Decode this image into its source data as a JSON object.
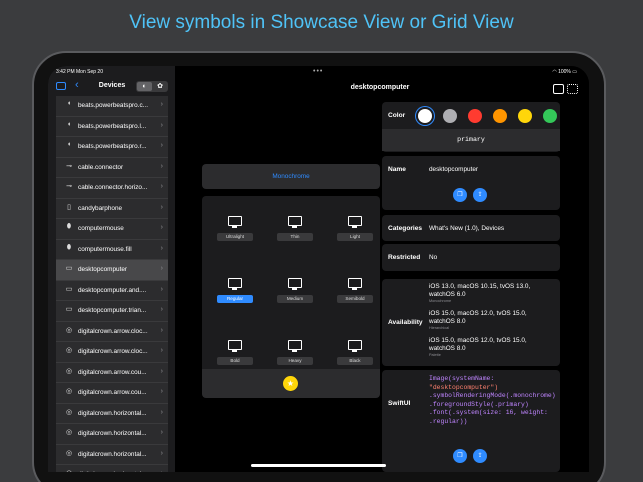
{
  "headline": "View symbols in Showcase View or Grid View",
  "status": {
    "time": "3:42 PM",
    "date": "Mon Sep 20",
    "battery": "100%"
  },
  "sidebar": {
    "title": "Devices",
    "items": [
      {
        "label": "beats.powerbeatspro.c...",
        "icon": "earbud-icon"
      },
      {
        "label": "beats.powerbeatspro.l...",
        "icon": "earbud-icon"
      },
      {
        "label": "beats.powerbeatspro.r...",
        "icon": "earbud-icon"
      },
      {
        "label": "cable.connector",
        "icon": "cable-icon"
      },
      {
        "label": "cable.connector.horizo...",
        "icon": "cable-icon"
      },
      {
        "label": "candybarphone",
        "icon": "phone-icon"
      },
      {
        "label": "computermouse",
        "icon": "mouse-icon"
      },
      {
        "label": "computermouse.fill",
        "icon": "mouse-icon"
      },
      {
        "label": "desktopcomputer",
        "icon": "desktop-icon",
        "selected": true
      },
      {
        "label": "desktopcomputer.and....",
        "icon": "desktop-icon"
      },
      {
        "label": "desktopcomputer.trian...",
        "icon": "desktop-icon"
      },
      {
        "label": "digitalcrown.arrow.cloc...",
        "icon": "crown-icon"
      },
      {
        "label": "digitalcrown.arrow.cloc...",
        "icon": "crown-icon"
      },
      {
        "label": "digitalcrown.arrow.cou...",
        "icon": "crown-icon"
      },
      {
        "label": "digitalcrown.arrow.cou...",
        "icon": "crown-icon"
      },
      {
        "label": "digitalcrown.horizontal...",
        "icon": "crown-icon"
      },
      {
        "label": "digitalcrown.horizontal...",
        "icon": "crown-icon"
      },
      {
        "label": "digitalcrown.horizontal...",
        "icon": "crown-icon"
      },
      {
        "label": "digitalcrown.horizontal...",
        "icon": "crown-icon"
      }
    ]
  },
  "main": {
    "title": "desktopcomputer",
    "rendering_mode": "Monochrome",
    "weights": [
      "Ultralight",
      "Thin",
      "Light",
      "Regular",
      "Medium",
      "Semibold",
      "Bold",
      "Heavy",
      "Black"
    ],
    "selected_weight": "Regular"
  },
  "details": {
    "color_label": "Color",
    "colors": [
      "#ffffff",
      "#aeaeb2",
      "#ff3b30",
      "#ff9500",
      "#ffd60a",
      "#34c759"
    ],
    "color_name": "primary",
    "name_label": "Name",
    "name_value": "desktopcomputer",
    "categories_label": "Categories",
    "categories_value": "What's New (1.0), Devices",
    "restricted_label": "Restricted",
    "restricted_value": "No",
    "availability_label": "Availability",
    "availability": [
      {
        "line1": "iOS 13.0, macOS 10.15, tvOS 13.0,",
        "line2": "watchOS 6.0",
        "mode": "Monochrome"
      },
      {
        "line1": "iOS 15.0, macOS 12.0, tvOS 15.0,",
        "line2": "watchOS 8.0",
        "mode": "Hierarchical"
      },
      {
        "line1": "iOS 15.0, macOS 12.0, tvOS 15.0,",
        "line2": "watchOS 8.0",
        "mode": "Palette"
      }
    ],
    "swiftui_label": "SwiftUI",
    "code": [
      {
        "text": "Image(systemName:",
        "color": "#bf85ff"
      },
      {
        "text": "\"desktopcomputer\")",
        "color": "#ff8170"
      },
      {
        "text": ".symbolRenderingMode(.monochrome)",
        "color": "#bf85ff"
      },
      {
        "text": ".foregroundStyle(.primary)",
        "color": "#bf85ff"
      },
      {
        "text": ".font(.system(size: 16, weight: .regular))",
        "color": "#bf85ff"
      }
    ]
  }
}
